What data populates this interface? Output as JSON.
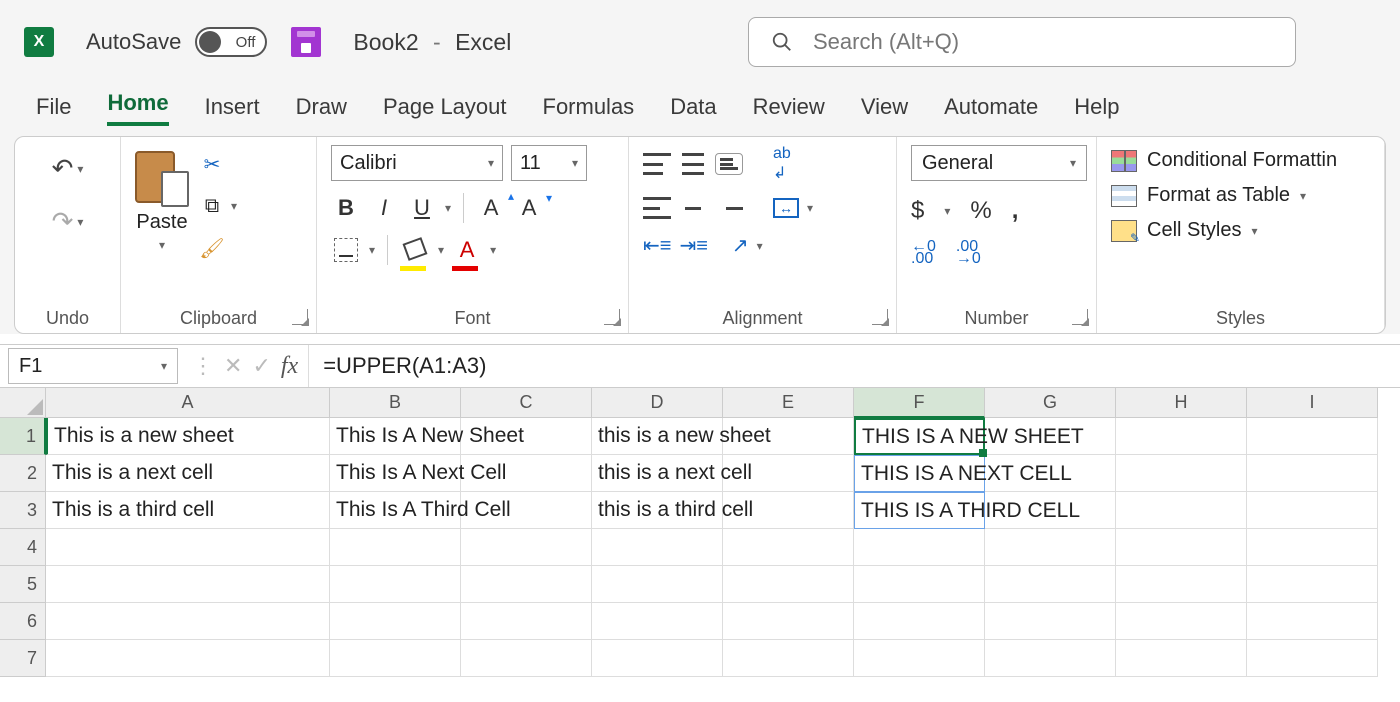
{
  "titlebar": {
    "autosave_label": "AutoSave",
    "autosave_state": "Off",
    "document": "Book2",
    "app": "Excel",
    "search_placeholder": "Search (Alt+Q)"
  },
  "tabs": [
    "File",
    "Home",
    "Insert",
    "Draw",
    "Page Layout",
    "Formulas",
    "Data",
    "Review",
    "View",
    "Automate",
    "Help"
  ],
  "active_tab": "Home",
  "ribbon": {
    "undo_label": "Undo",
    "clipboard": {
      "paste_label": "Paste",
      "group_label": "Clipboard"
    },
    "font": {
      "name": "Calibri",
      "size": "11",
      "group_label": "Font"
    },
    "alignment": {
      "group_label": "Alignment"
    },
    "number": {
      "format": "General",
      "group_label": "Number"
    },
    "styles": {
      "cf": "Conditional Formattin",
      "ft": "Format as Table",
      "cs": "Cell Styles",
      "group_label": "Styles"
    }
  },
  "formula_bar": {
    "name_box": "F1",
    "formula": "=UPPER(A1:A3)"
  },
  "sheet": {
    "columns": [
      "A",
      "B",
      "C",
      "D",
      "E",
      "F",
      "G",
      "H",
      "I"
    ],
    "data": {
      "A": [
        "This is a new sheet",
        "This is a next cell",
        "This is a third cell",
        "",
        "",
        "",
        ""
      ],
      "B": [
        "This Is A New Sheet",
        "This Is A Next Cell",
        "This Is A Third Cell",
        "",
        "",
        "",
        ""
      ],
      "C": [
        "",
        "",
        "",
        "",
        "",
        "",
        ""
      ],
      "D": [
        "this is a new sheet",
        "this is a next cell",
        "this is a third cell",
        "",
        "",
        "",
        ""
      ],
      "E": [
        "",
        "",
        "",
        "",
        "",
        "",
        ""
      ],
      "F": [
        "THIS IS A NEW SHEET",
        "THIS IS A NEXT CELL",
        "THIS IS A THIRD CELL",
        "",
        "",
        "",
        ""
      ],
      "G": [
        "",
        "",
        "",
        "",
        "",
        "",
        ""
      ],
      "H": [
        "",
        "",
        "",
        "",
        "",
        "",
        ""
      ],
      "I": [
        "",
        "",
        "",
        "",
        "",
        "",
        ""
      ]
    },
    "active_cell": "F1",
    "spill_range": [
      "F1",
      "F2",
      "F3"
    ]
  }
}
